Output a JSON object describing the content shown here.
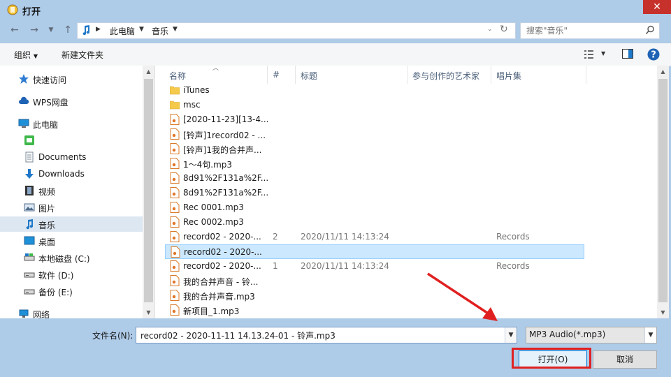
{
  "window": {
    "title": "打开",
    "close_glyph": "✕"
  },
  "address": {
    "crumbs": [
      "此电脑",
      "音乐"
    ],
    "search_placeholder": "搜索\"音乐\""
  },
  "toolbar": {
    "organize": "组织",
    "new_folder": "新建文件夹"
  },
  "nav": {
    "items": [
      {
        "label": "快速访问",
        "icon": "star-icon"
      },
      {
        "label": "WPS网盘",
        "icon": "cloud-icon"
      },
      {
        "label": "此电脑",
        "icon": "computer-icon"
      },
      {
        "label": "",
        "icon": "device-icon"
      },
      {
        "label": "Documents",
        "icon": "document-icon"
      },
      {
        "label": "Downloads",
        "icon": "download-icon"
      },
      {
        "label": "视频",
        "icon": "video-icon"
      },
      {
        "label": "图片",
        "icon": "picture-icon"
      },
      {
        "label": "音乐",
        "icon": "music-icon"
      },
      {
        "label": "桌面",
        "icon": "desktop-icon"
      },
      {
        "label": "本地磁盘 (C:)",
        "icon": "drive-icon"
      },
      {
        "label": "软件 (D:)",
        "icon": "drive-icon"
      },
      {
        "label": "备份 (E:)",
        "icon": "drive-icon"
      },
      {
        "label": "网络",
        "icon": "network-icon"
      }
    ]
  },
  "columns": {
    "name": "名称",
    "num": "#",
    "title": "标题",
    "artist": "参与创作的艺术家",
    "album": "唱片集"
  },
  "files": [
    {
      "name": "iTunes",
      "type": "folder",
      "num": "",
      "date": "",
      "album": ""
    },
    {
      "name": "msc",
      "type": "folder",
      "num": "",
      "date": "",
      "album": ""
    },
    {
      "name": "[2020-11-23][13-4...",
      "type": "audio",
      "num": "",
      "date": "",
      "album": ""
    },
    {
      "name": "[铃声]1record02 - ...",
      "type": "audio",
      "num": "",
      "date": "",
      "album": ""
    },
    {
      "name": "[铃声]1我的合并声...",
      "type": "audio",
      "num": "",
      "date": "",
      "album": ""
    },
    {
      "name": "1～4句.mp3",
      "type": "audio",
      "num": "",
      "date": "",
      "album": ""
    },
    {
      "name": "8d91%2F131a%2F...",
      "type": "audio",
      "num": "",
      "date": "",
      "album": ""
    },
    {
      "name": "8d91%2F131a%2F...",
      "type": "audio",
      "num": "",
      "date": "",
      "album": ""
    },
    {
      "name": "Rec 0001.mp3",
      "type": "audio",
      "num": "",
      "date": "",
      "album": ""
    },
    {
      "name": "Rec 0002.mp3",
      "type": "audio",
      "num": "",
      "date": "",
      "album": ""
    },
    {
      "name": "record02 - 2020-...",
      "type": "audio",
      "num": "2",
      "date": "2020/11/11 14:13:24",
      "album": "Records"
    },
    {
      "name": "record02 - 2020-...",
      "type": "audio",
      "num": "",
      "date": "",
      "album": ""
    },
    {
      "name": "record02 - 2020-...",
      "type": "audio",
      "num": "1",
      "date": "2020/11/11 14:13:24",
      "album": "Records"
    },
    {
      "name": "我的合并声音 - 铃...",
      "type": "audio",
      "num": "",
      "date": "",
      "album": ""
    },
    {
      "name": "我的合并声音.mp3",
      "type": "audio",
      "num": "",
      "date": "",
      "album": ""
    },
    {
      "name": "新项目_1.mp3",
      "type": "audio",
      "num": "",
      "date": "",
      "album": ""
    }
  ],
  "bottom": {
    "filename_label": "文件名(N):",
    "filename_value": "record02 - 2020-11-11 14.13.24-01 - 铃声.mp3",
    "filetype": "MP3 Audio(*.mp3)",
    "open": "打开(O)",
    "cancel": "取消"
  },
  "colors": {
    "accent": "#0078d7",
    "highlight": "#e02020",
    "selection": "#cce8ff"
  }
}
